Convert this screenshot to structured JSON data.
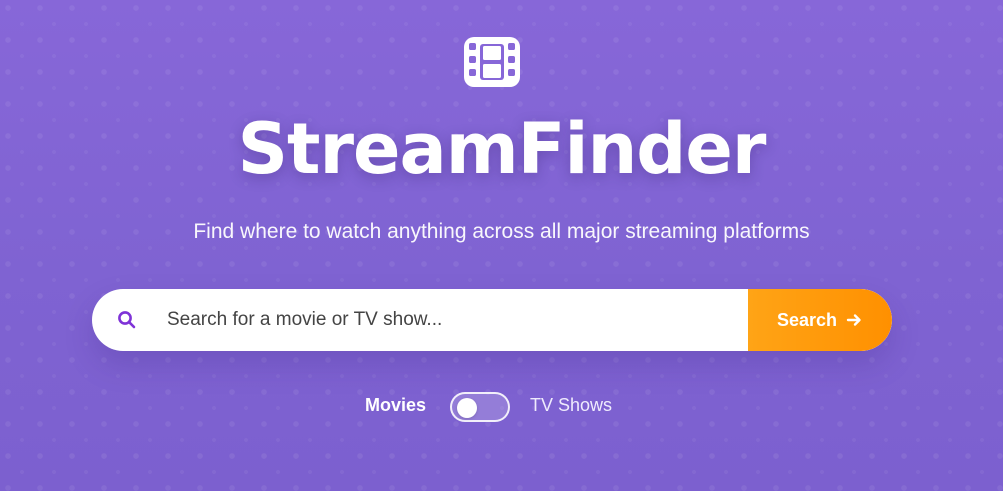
{
  "hero": {
    "title": "StreamFinder",
    "subtitle": "Find where to watch anything across all major streaming platforms",
    "logo_icon": "film-icon"
  },
  "search": {
    "placeholder": "Search for a movie or TV show...",
    "button_label": "Search",
    "search_icon": "search-icon",
    "arrow_icon": "arrow-right-icon"
  },
  "toggle": {
    "left_label": "Movies",
    "right_label": "TV Shows",
    "selected": "Movies"
  },
  "colors": {
    "background_start": "#8767d8",
    "background_end": "#7c60cf",
    "accent_orange": "#ff9800",
    "search_icon_purple": "#7f33d7",
    "text_white": "#ffffff"
  }
}
